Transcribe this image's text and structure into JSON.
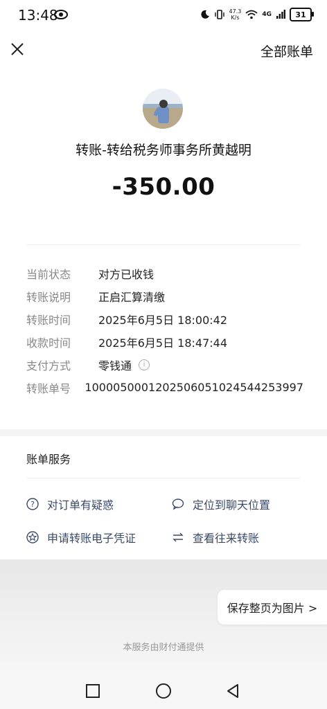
{
  "status": {
    "time": "13:48",
    "net_speed_value": "47.3",
    "net_speed_unit": "K/s",
    "signal": "4G",
    "battery": "31"
  },
  "header": {
    "right_link": "全部账单"
  },
  "transfer": {
    "title": "转账-转给税务师事务所黄越明",
    "amount": "-350.00"
  },
  "details": [
    {
      "label": "当前状态",
      "value": "对方已收钱"
    },
    {
      "label": "转账说明",
      "value": "正启汇算清缴"
    },
    {
      "label": "转账时间",
      "value": "2025年6月5日 18:00:42"
    },
    {
      "label": "收款时间",
      "value": "2025年6月5日 18:47:44"
    },
    {
      "label": "支付方式",
      "value": "零钱通"
    },
    {
      "label": "转账单号",
      "value": "1000050001202506051024544253997"
    }
  ],
  "services": {
    "title": "账单服务",
    "items": [
      {
        "label": "对订单有疑惑",
        "icon": "question-icon"
      },
      {
        "label": "定位到聊天位置",
        "icon": "chat-bubble-icon"
      },
      {
        "label": "申请转账电子凭证",
        "icon": "star-badge-icon"
      },
      {
        "label": "查看往来转账",
        "icon": "swap-arrows-icon"
      }
    ]
  },
  "save_button": "保存整页为图片 >",
  "footer": "本服务由财付通提供"
}
